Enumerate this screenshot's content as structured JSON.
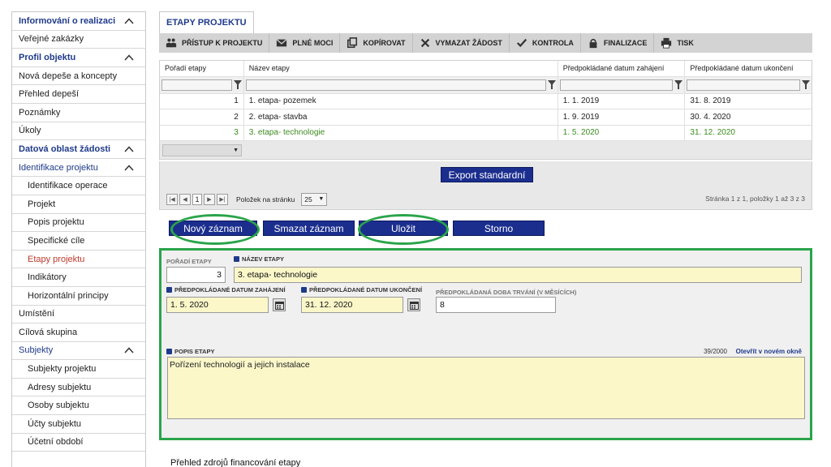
{
  "sidebar": {
    "items": [
      {
        "label": "Informování o realizaci",
        "type": "head",
        "chevron": true
      },
      {
        "label": "Veřejné zakázky",
        "type": "item"
      },
      {
        "label": "Profil objektu",
        "type": "head",
        "chevron": true
      },
      {
        "label": "Nová depeše a koncepty",
        "type": "item"
      },
      {
        "label": "Přehled depeší",
        "type": "item"
      },
      {
        "label": "Poznámky",
        "type": "item"
      },
      {
        "label": "Úkoly",
        "type": "item"
      },
      {
        "label": "Datová oblast žádosti",
        "type": "head",
        "chevron": true
      },
      {
        "label": "Identifikace projektu",
        "type": "subhead",
        "chevron": true
      },
      {
        "label": "Identifikace operace",
        "type": "sub"
      },
      {
        "label": "Projekt",
        "type": "sub"
      },
      {
        "label": "Popis projektu",
        "type": "sub"
      },
      {
        "label": "Specifické cíle",
        "type": "sub"
      },
      {
        "label": "Etapy projektu",
        "type": "sub",
        "active": true
      },
      {
        "label": "Indikátory",
        "type": "sub"
      },
      {
        "label": "Horizontální principy",
        "type": "sub"
      },
      {
        "label": "Umístění",
        "type": "item"
      },
      {
        "label": "Cílová skupina",
        "type": "item"
      },
      {
        "label": "Subjekty",
        "type": "subhead",
        "chevron": true
      },
      {
        "label": "Subjekty projektu",
        "type": "sub"
      },
      {
        "label": "Adresy subjektu",
        "type": "sub"
      },
      {
        "label": "Osoby subjektu",
        "type": "sub"
      },
      {
        "label": "Účty subjektu",
        "type": "sub"
      },
      {
        "label": "Účetní období",
        "type": "sub"
      }
    ]
  },
  "tab": {
    "label": "ETAPY PROJEKTU"
  },
  "toolbar": {
    "access": "PŘÍSTUP K PROJEKTU",
    "proxies": "PLNÉ MOCI",
    "copy": "KOPÍROVAT",
    "delete": "VYMAZAT ŽÁDOST",
    "check": "KONTROLA",
    "finalize": "FINALIZACE",
    "print": "TISK"
  },
  "grid": {
    "headers": [
      "Pořadí etapy",
      "Název etapy",
      "Předpokládané datum zahájení",
      "Předpokládané datum ukončení"
    ],
    "rows": [
      {
        "order": "1",
        "name": "1. etapa- pozemek",
        "start": "1. 1. 2019",
        "end": "31. 8. 2019"
      },
      {
        "order": "2",
        "name": "2. etapa- stavba",
        "start": "1. 9. 2019",
        "end": "30. 4. 2020"
      },
      {
        "order": "3",
        "name": "3. etapa- technologie",
        "start": "1. 5. 2020",
        "end": "31. 12. 2020"
      }
    ],
    "selected_row": 3
  },
  "export_button": "Export standardní",
  "pager": {
    "current_page": "1",
    "page_size_label": "Položek na stránku",
    "page_size": "25",
    "info": "Stránka 1 z 1, položky 1 až 3 z 3"
  },
  "actions": {
    "new": "Nový záznam",
    "delete": "Smazat záznam",
    "save": "Uložit",
    "cancel": "Storno"
  },
  "form": {
    "order_label": "POŘADÍ ETAPY",
    "order_value": "3",
    "name_label": "NÁZEV ETAPY",
    "name_value": "3. etapa- technologie",
    "start_label": "PŘEDPOKLÁDANÉ DATUM ZAHÁJENÍ",
    "start_value": "1. 5. 2020",
    "end_label": "PŘEDPOKLÁDANÉ DATUM UKONČENÍ",
    "end_value": "31. 12. 2020",
    "duration_label": "PŘEDPOKLÁDANÁ DOBA TRVÁNÍ (V MĚSÍCÍCH)",
    "duration_value": "8",
    "desc_label": "POPIS ETAPY",
    "desc_counter": "39/2000",
    "open_new_window": "Otevřít v novém okně",
    "desc_value": "Pořízení technologií a jejich instalace"
  },
  "bottom_title": "Přehled zdrojů financování etapy",
  "colors": {
    "accent": "#1f3a8a",
    "button": "#1b2e8e",
    "highlight": "#2aa44a",
    "selected_text": "#3c8c1e",
    "active_nav": "#c0392b",
    "input_yellow": "#fbf7c9"
  }
}
